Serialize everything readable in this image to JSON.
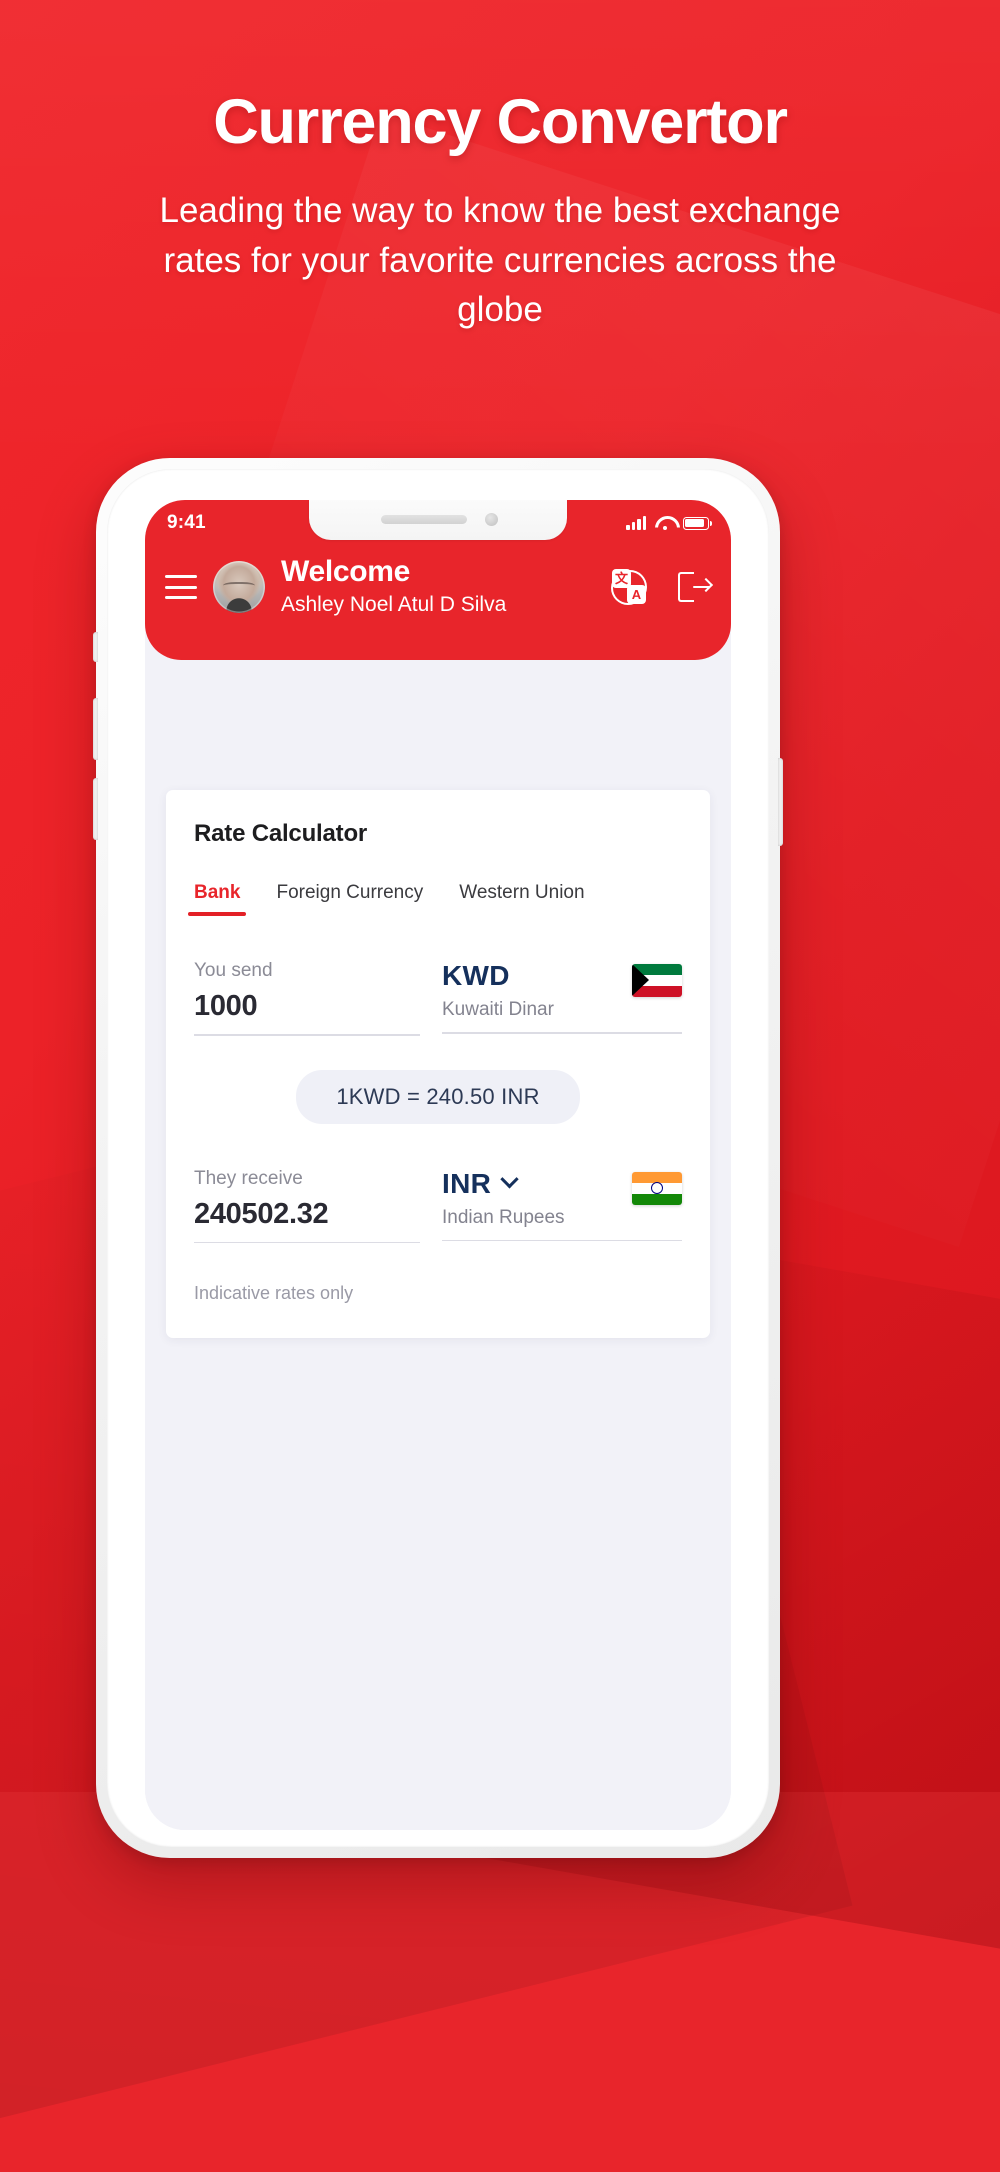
{
  "hero": {
    "title": "Currency Convertor",
    "subtitle": "Leading the way to know the best exchange rates for your favorite currencies across the globe"
  },
  "colors": {
    "brand_red": "#e8252b",
    "accent_red": "#e32026",
    "navy": "#15305c",
    "screen_bg": "#f2f2f8",
    "card_bg": "#ffffff"
  },
  "phone": {
    "status_bar": {
      "time": "9:41",
      "signal_icon": "cellular-signal-icon",
      "wifi_icon": "wifi-icon",
      "battery_icon": "battery-icon"
    },
    "header": {
      "menu_icon": "hamburger-menu-icon",
      "avatar_icon": "user-avatar",
      "greeting": "Welcome",
      "user_name": "Ashley Noel Atul D Silva",
      "translate_icon": "translate-language-icon",
      "translate_tile_1": "文",
      "translate_tile_2": "A",
      "logout_icon": "logout-icon"
    },
    "card": {
      "title": "Rate Calculator",
      "tabs": [
        {
          "label": "Bank",
          "active": true
        },
        {
          "label": "Foreign Currency",
          "active": false
        },
        {
          "label": "Western Union",
          "active": false
        }
      ],
      "send": {
        "label": "You send",
        "amount": "1000",
        "currency_code": "KWD",
        "currency_name": "Kuwaiti Dinar",
        "flag_icon": "kuwait-flag-icon"
      },
      "rate_pill": "1KWD = 240.50 INR",
      "receive": {
        "label": "They receive",
        "amount": "240502.32",
        "currency_code": "INR",
        "currency_name": "Indian Rupees",
        "flag_icon": "india-flag-icon",
        "dropdown_icon": "chevron-down-icon"
      },
      "footnote": "Indicative rates only"
    }
  }
}
